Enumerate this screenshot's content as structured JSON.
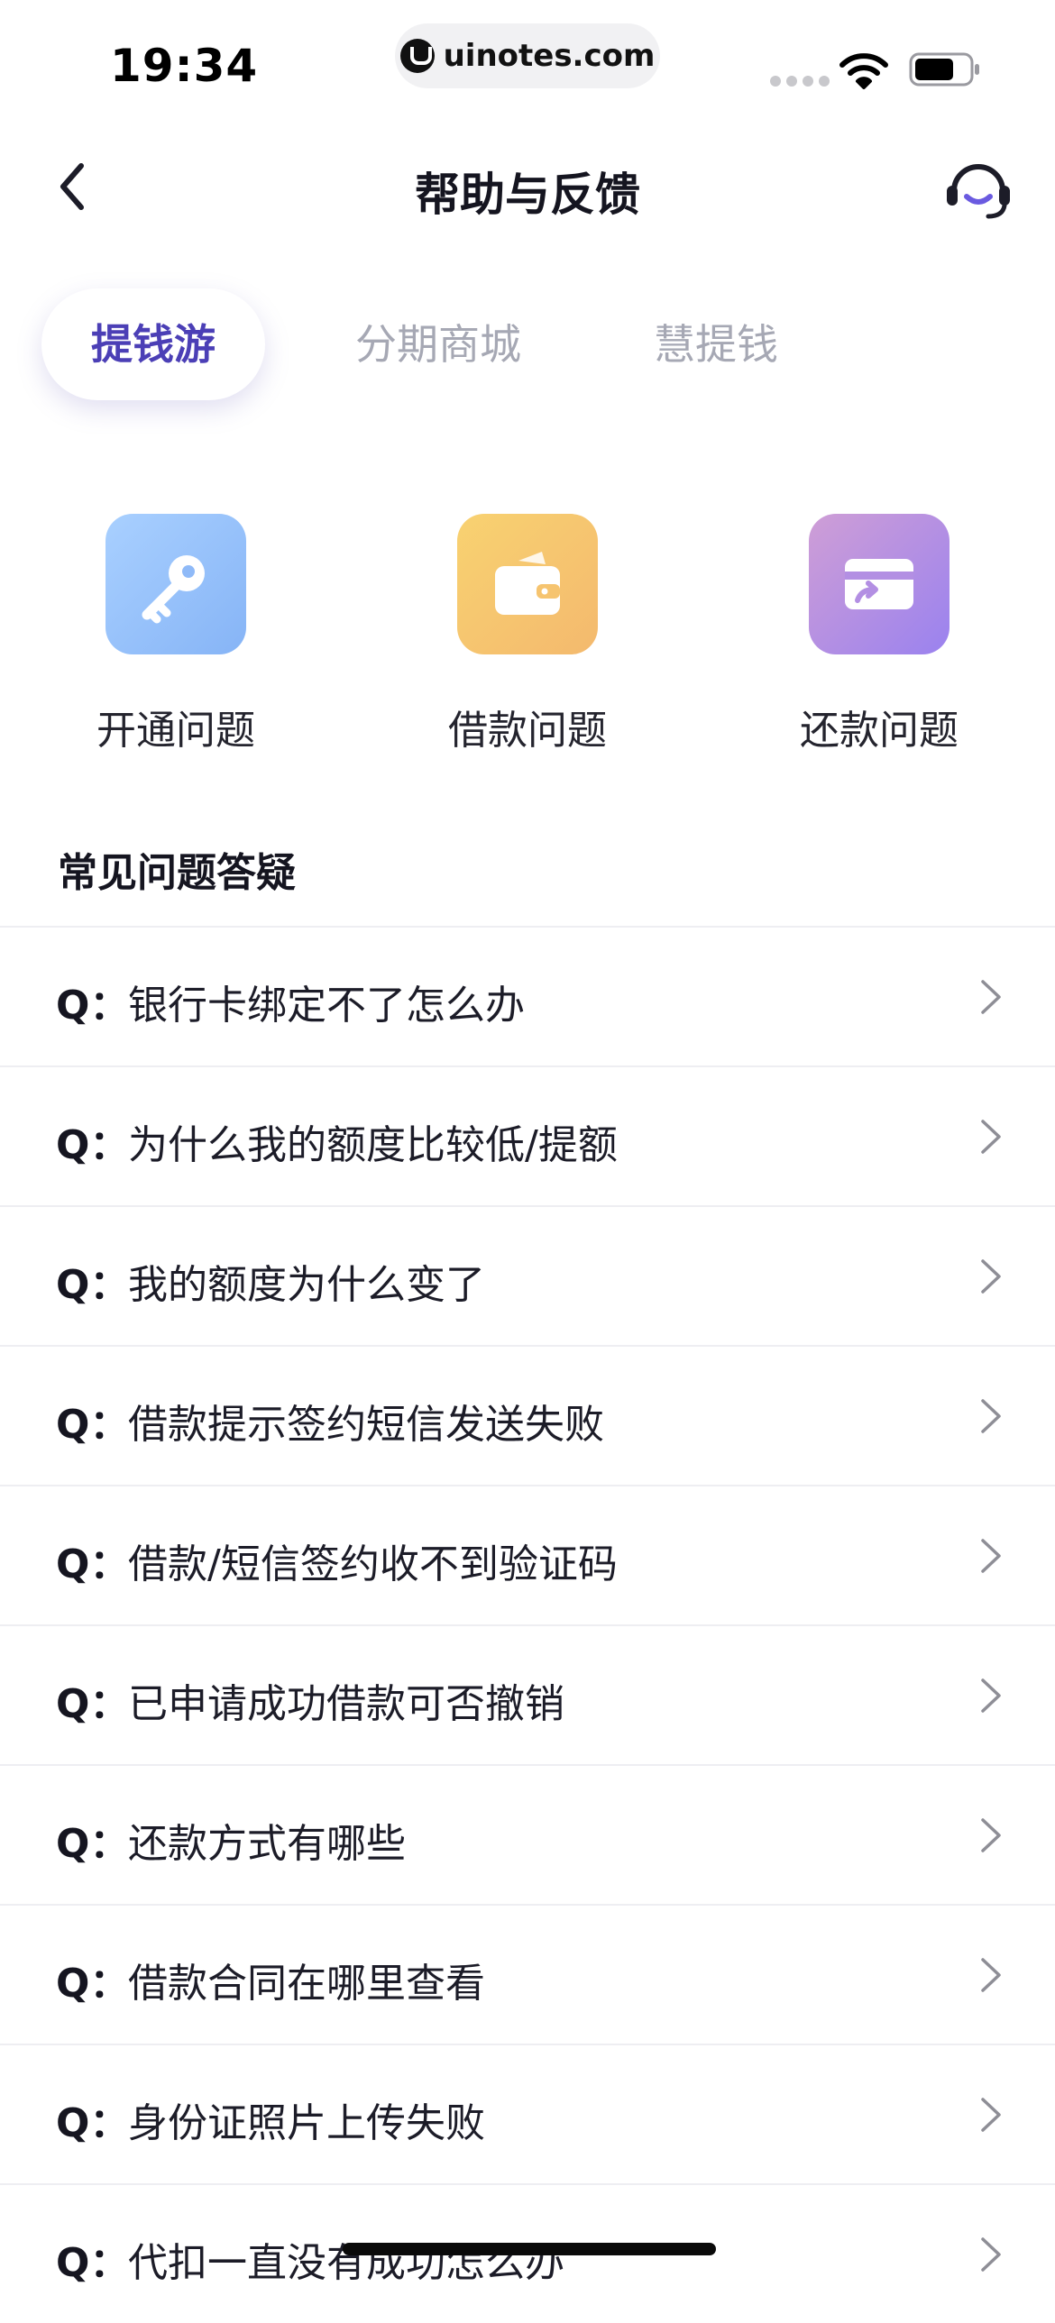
{
  "status_bar": {
    "time": "19:34",
    "url": "uinotes.com",
    "icons": [
      "signal-dots-icon",
      "wifi-icon",
      "battery-icon"
    ]
  },
  "nav": {
    "title": "帮助与反馈",
    "back_icon": "chevron-left-icon",
    "service_icon": "headset-icon"
  },
  "tabs": [
    {
      "label": "提钱游",
      "active": true
    },
    {
      "label": "分期商城",
      "active": false
    },
    {
      "label": "慧提钱",
      "active": false
    }
  ],
  "categories": [
    {
      "label": "开通问题",
      "icon": "key-icon",
      "color": "#8fbaf8"
    },
    {
      "label": "借款问题",
      "icon": "wallet-icon",
      "color": "#f6c46f"
    },
    {
      "label": "还款问题",
      "icon": "card-transfer-icon",
      "color": "#b38fe3"
    }
  ],
  "faq": {
    "title": "常见问题答疑",
    "prefix": "Q：",
    "items": [
      "银行卡绑定不了怎么办",
      "为什么我的额度比较低/提额",
      "我的额度为什么变了",
      "借款提示签约短信发送失败",
      "借款/短信签约收不到验证码",
      "已申请成功借款可否撤销",
      "还款方式有哪些",
      "借款合同在哪里查看",
      "身份证照片上传失败",
      "代扣一直没有成功怎么办"
    ]
  },
  "colors": {
    "accent": "#4b3fb6",
    "inactive_tab": "#a6a8b4",
    "divider": "#eeeef2"
  }
}
